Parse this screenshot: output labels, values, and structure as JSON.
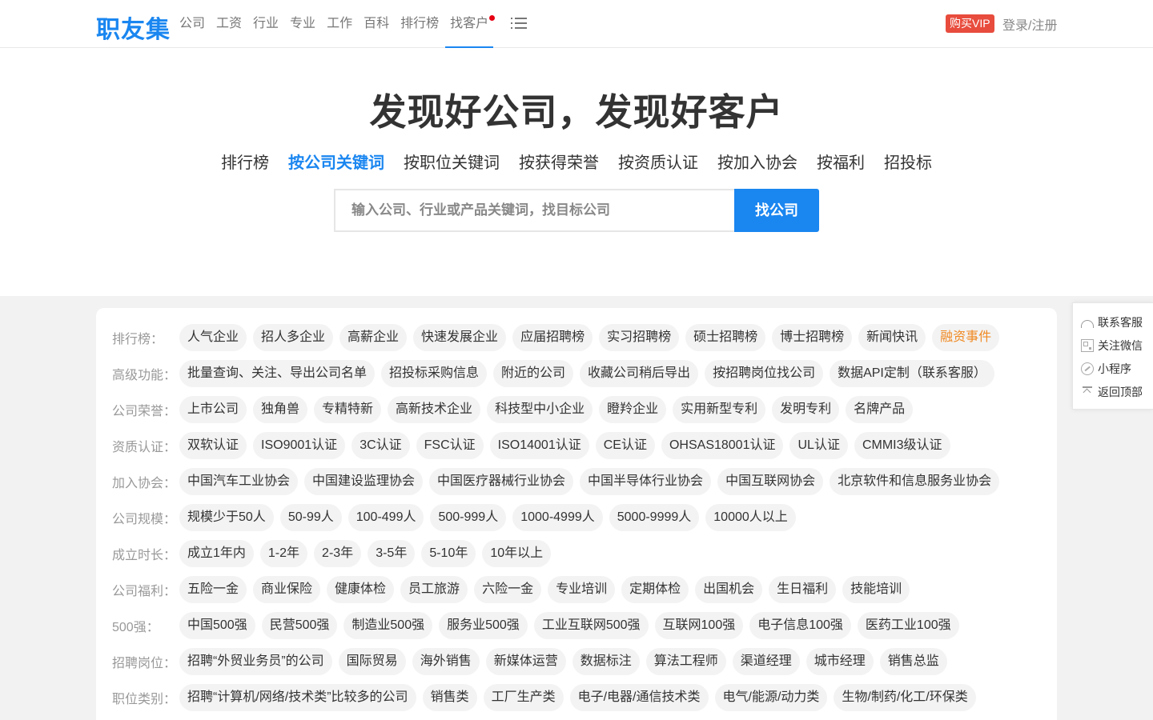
{
  "header": {
    "logo": "职友集",
    "nav": [
      "公司",
      "工资",
      "行业",
      "专业",
      "工作",
      "百科",
      "排行榜",
      "找客户"
    ],
    "active_nav": "找客户",
    "vip": "购买VIP",
    "login": "登录/注册"
  },
  "hero": {
    "title": "发现好公司，发现好客户",
    "tabs": [
      "排行榜",
      "按公司关键词",
      "按职位关键词",
      "按获得荣誉",
      "按资质认证",
      "按加入协会",
      "按福利",
      "招投标"
    ],
    "active_tab": "按公司关键词",
    "search_placeholder": "输入公司、行业或产品关键词，找目标公司",
    "search_button": "找公司"
  },
  "filters": [
    {
      "label": "排行榜：",
      "tags": [
        "人气企业",
        "招人多企业",
        "高薪企业",
        "快速发展企业",
        "应届招聘榜",
        "实习招聘榜",
        "硕士招聘榜",
        "博士招聘榜",
        "新闻快讯",
        "融资事件"
      ],
      "highlight": "融资事件"
    },
    {
      "label": "高级功能：",
      "tags": [
        "批量查询、关注、导出公司名单",
        "招投标采购信息",
        "附近的公司",
        "收藏公司稍后导出",
        "按招聘岗位找公司",
        "数据API定制（联系客服）"
      ]
    },
    {
      "label": "公司荣誉：",
      "tags": [
        "上市公司",
        "独角兽",
        "专精特新",
        "高新技术企业",
        "科技型中小企业",
        "瞪羚企业",
        "实用新型专利",
        "发明专利",
        "名牌产品"
      ]
    },
    {
      "label": "资质认证：",
      "tags": [
        "双软认证",
        "ISO9001认证",
        "3C认证",
        "FSC认证",
        "ISO14001认证",
        "CE认证",
        "OHSAS18001认证",
        "UL认证",
        "CMMI3级认证"
      ]
    },
    {
      "label": "加入协会：",
      "tags": [
        "中国汽车工业协会",
        "中国建设监理协会",
        "中国医疗器械行业协会",
        "中国半导体行业协会",
        "中国互联网协会",
        "北京软件和信息服务业协会"
      ]
    },
    {
      "label": "公司规模：",
      "tags": [
        "规模少于50人",
        "50-99人",
        "100-499人",
        "500-999人",
        "1000-4999人",
        "5000-9999人",
        "10000人以上"
      ]
    },
    {
      "label": "成立时长：",
      "tags": [
        "成立1年内",
        "1-2年",
        "2-3年",
        "3-5年",
        "5-10年",
        "10年以上"
      ]
    },
    {
      "label": "公司福利：",
      "tags": [
        "五险一金",
        "商业保险",
        "健康体检",
        "员工旅游",
        "六险一金",
        "专业培训",
        "定期体检",
        "出国机会",
        "生日福利",
        "技能培训"
      ]
    },
    {
      "label": "500强：",
      "tags": [
        "中国500强",
        "民营500强",
        "制造业500强",
        "服务业500强",
        "工业互联网500强",
        "互联网100强",
        "电子信息100强",
        "医药工业100强"
      ]
    },
    {
      "label": "招聘岗位：",
      "tags": [
        "招聘“外贸业务员”的公司",
        "国际贸易",
        "海外销售",
        "新媒体运营",
        "数据标注",
        "算法工程师",
        "渠道经理",
        "城市经理",
        "销售总监"
      ]
    },
    {
      "label": "职位类别：",
      "tags": [
        "招聘“计算机/网络/技术类”比较多的公司",
        "销售类",
        "工厂生产类",
        "电子/电器/通信技术类",
        "电气/能源/动力类",
        "生物/制药/化工/环保类"
      ]
    }
  ],
  "sidebar": [
    {
      "label": "联系客服",
      "icon": "headset-icon"
    },
    {
      "label": "关注微信",
      "icon": "qrcode-icon"
    },
    {
      "label": "小程序",
      "icon": "mini-program-icon"
    },
    {
      "label": "返回顶部",
      "icon": "back-to-top-icon"
    }
  ],
  "colors": {
    "brand": "#1a86f0",
    "vip": "#e84c3d",
    "highlight": "#f08a24",
    "dot": "#e60012"
  }
}
